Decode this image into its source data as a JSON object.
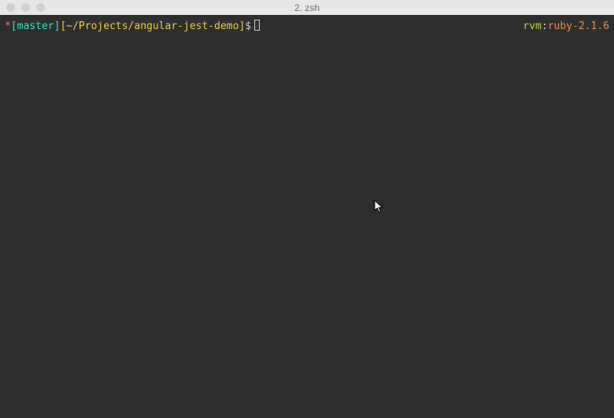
{
  "window": {
    "title": "2. zsh"
  },
  "prompt": {
    "asterisk": "*",
    "branch_open": "[",
    "branch": "master",
    "branch_close": "]",
    "path_open": "[",
    "path": "~/Projects/angular-jest-demo",
    "path_close": "]",
    "symbol": "$"
  },
  "rvm": {
    "label": "rvm",
    "colon": ":",
    "version": "ruby-2.1.6"
  }
}
